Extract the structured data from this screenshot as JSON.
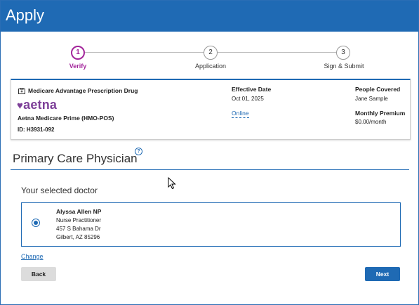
{
  "header": {
    "title": "Apply"
  },
  "stepper": {
    "steps": [
      {
        "number": "1",
        "label": "Verify",
        "active": true
      },
      {
        "number": "2",
        "label": "Application",
        "active": false
      },
      {
        "number": "3",
        "label": "Sign & Submit",
        "active": false
      }
    ]
  },
  "plan": {
    "type": "Medicare Advantage Prescription Drug",
    "brand": "aetna",
    "name": "Aetna Medicare Prime (HMO-POS)",
    "id": "ID: H3931-092",
    "effective_date_label": "Effective Date",
    "effective_date_value": "Oct 01, 2025",
    "online_link": "Online",
    "people_covered_label": "People Covered",
    "people_covered_value": "Jane Sample",
    "monthly_premium_label": "Monthly Premium",
    "monthly_premium_value": "$0.00/month"
  },
  "section": {
    "title": "Primary Care Physician",
    "help": "?",
    "selected_label": "Your selected doctor"
  },
  "doctor": {
    "name": "Alyssa Allen NP",
    "specialty": "Nurse Practitioner",
    "address1": "457 S Bahama Dr",
    "address2": "Gilbert, AZ 85296",
    "selected": true
  },
  "actions": {
    "change": "Change",
    "back": "Back",
    "next": "Next"
  },
  "colors": {
    "brand_blue": "#1f6ab4",
    "active_step": "#a3259b",
    "aetna_purple": "#7d3f98"
  }
}
